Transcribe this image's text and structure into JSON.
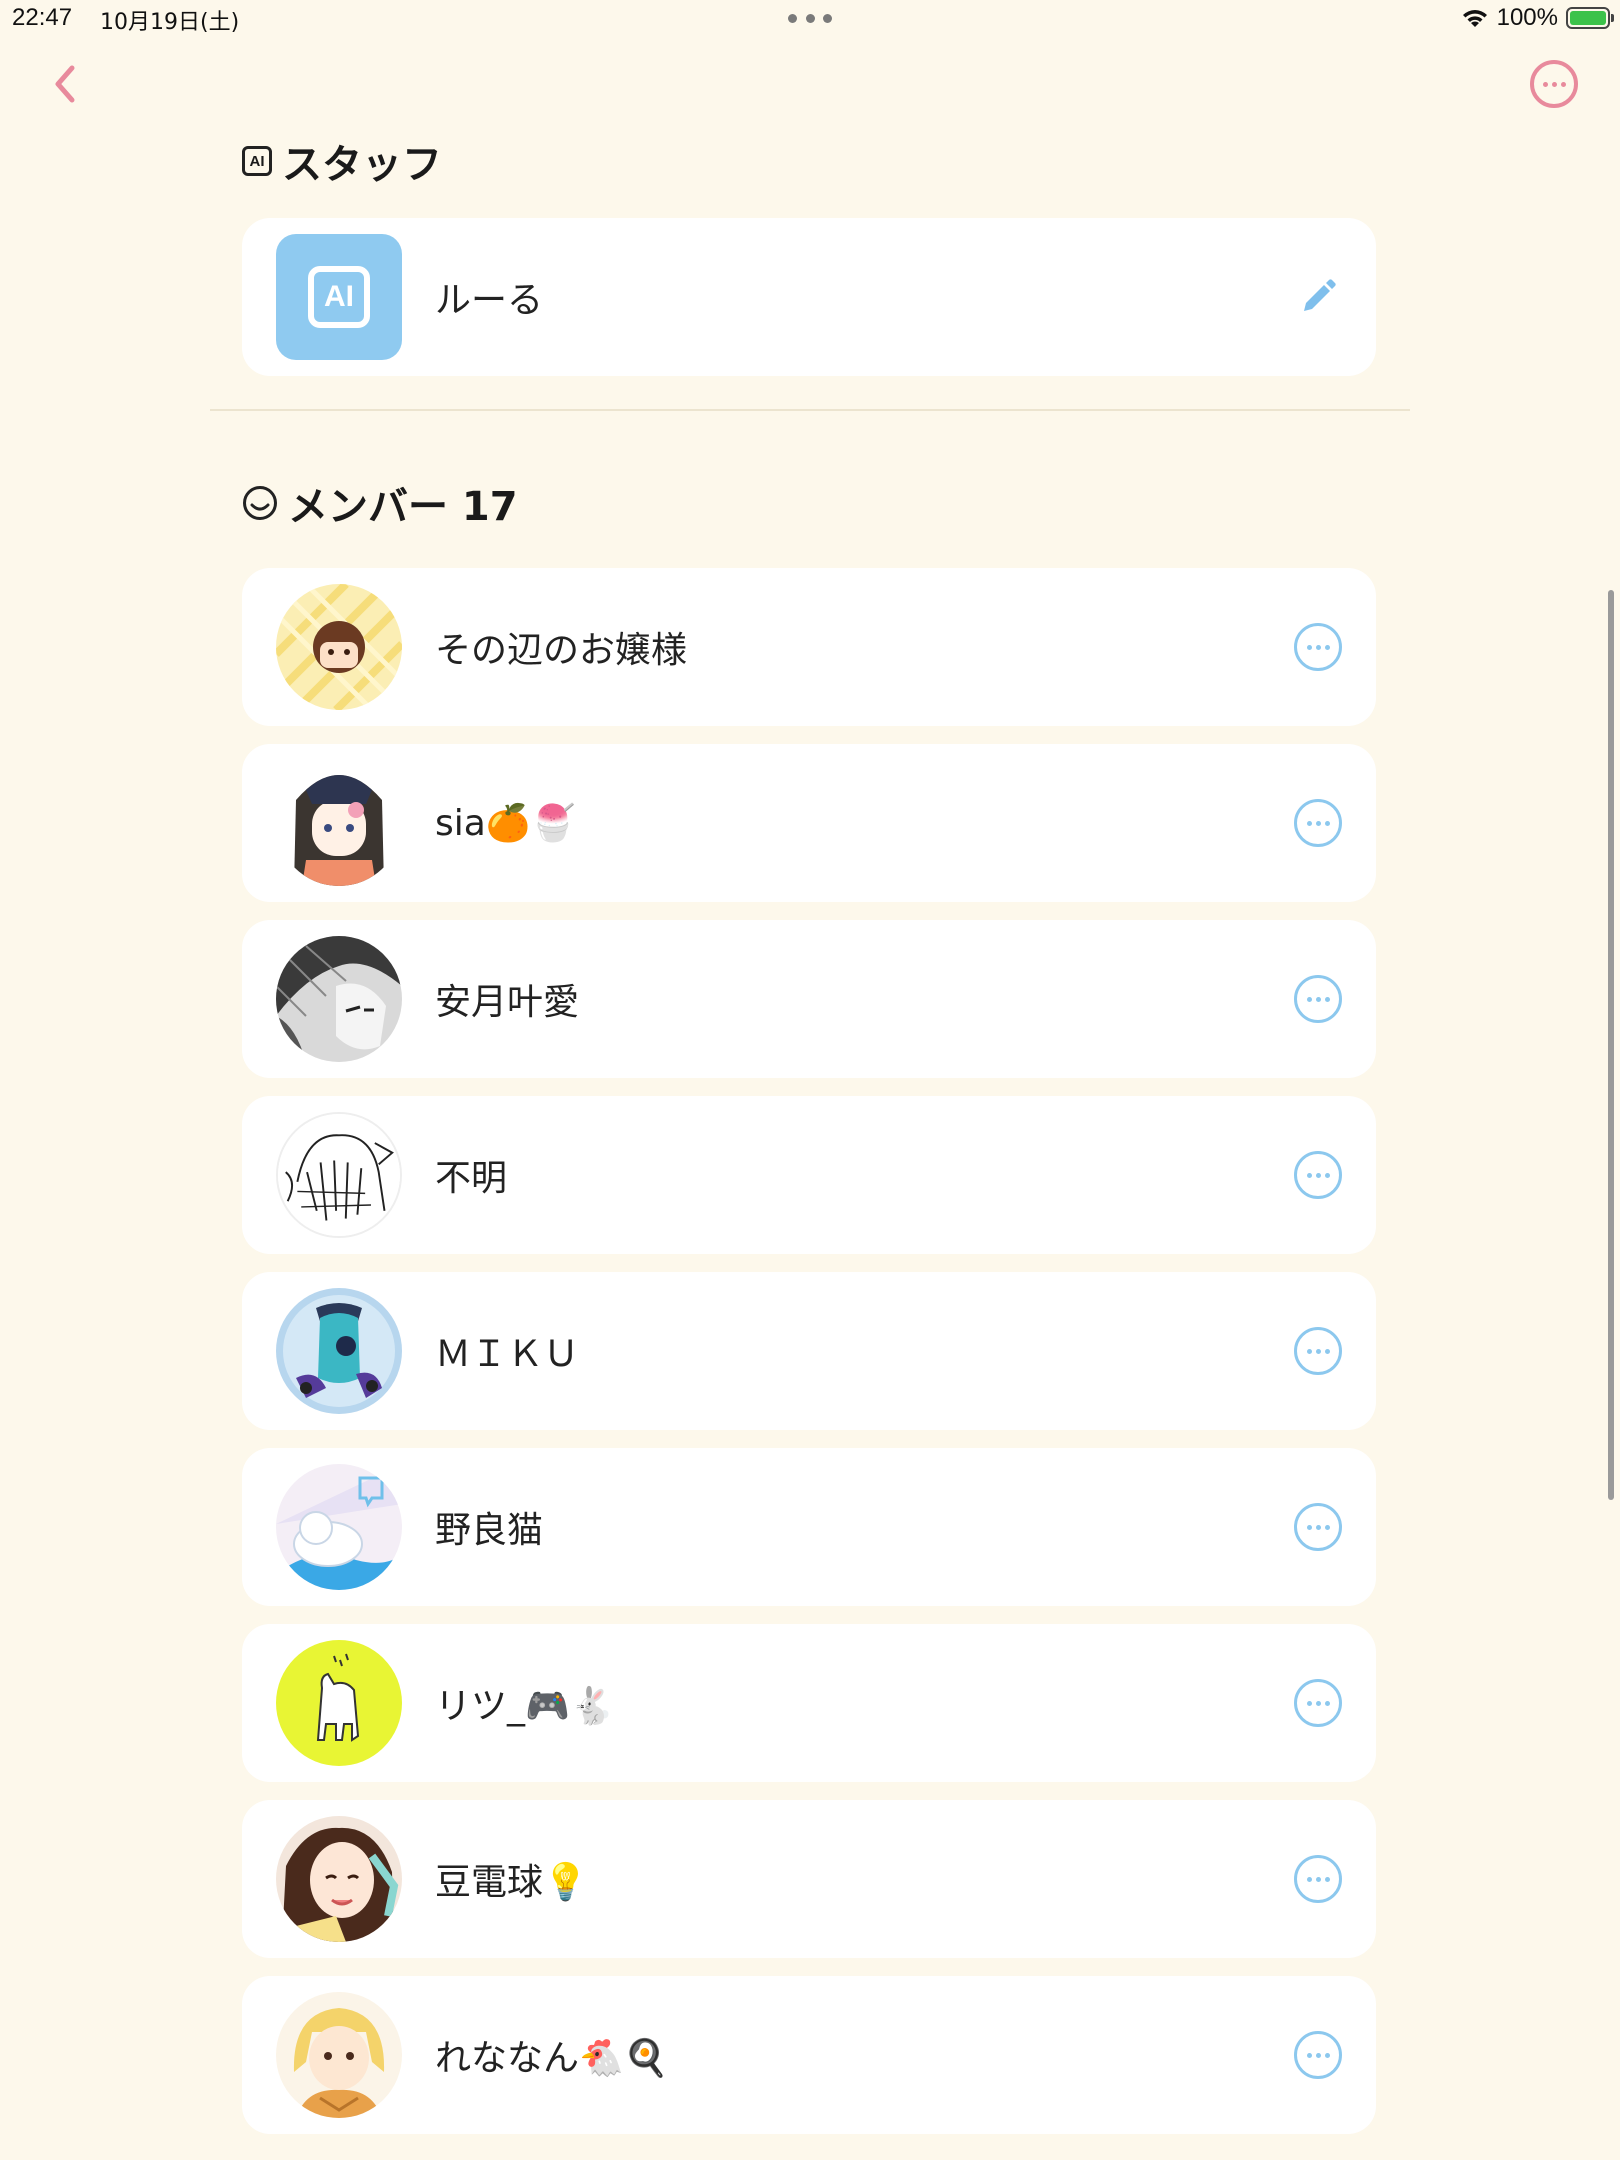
{
  "status_bar": {
    "time": "22:47",
    "date": "10月19日(土)",
    "battery": "100%"
  },
  "staff": {
    "header_badge": "AI",
    "title": "スタッフ",
    "items": [
      {
        "badge": "AI",
        "name": "ルーる"
      }
    ]
  },
  "members": {
    "title": "メンバー 17",
    "items": [
      {
        "name": "その辺のお嬢様"
      },
      {
        "name": "sia🍊🍧"
      },
      {
        "name": "安月叶愛"
      },
      {
        "name": "不明"
      },
      {
        "name": "ＭＩＫＵ"
      },
      {
        "name": "野良猫"
      },
      {
        "name": "リツ_🎮🐇"
      },
      {
        "name": "豆電球💡"
      },
      {
        "name": "れななん🐔🍳"
      }
    ]
  },
  "colors": {
    "background": "#fdf8eb",
    "accent_pink": "#e88a9c",
    "accent_blue": "#8cc8ee",
    "ai_avatar": "#8fcaf0"
  }
}
